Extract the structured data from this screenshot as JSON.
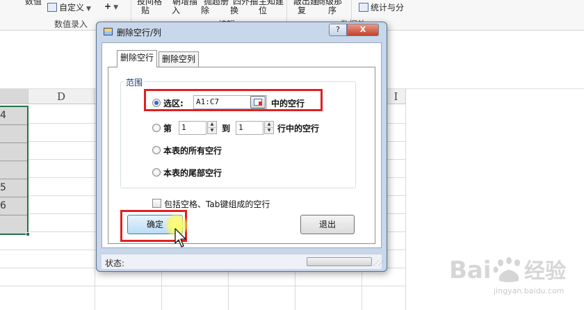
{
  "ribbon": {
    "items": [
      "数值",
      "自定义",
      "+",
      "贴",
      "入",
      "除",
      "换",
      "位",
      "复",
      "序",
      "统计与分"
    ],
    "top_fragments": [
      "投间格",
      "朝增描",
      "抛超册",
      "四外抽",
      "主知建",
      "敲出建",
      "商级那"
    ],
    "groups": [
      "数值录入",
      "编辑",
      "数据处"
    ]
  },
  "grid": {
    "columns": [
      "D",
      "I"
    ],
    "cell_values": [
      "4",
      "5",
      "6"
    ]
  },
  "dialog": {
    "title": "删除空行/列",
    "help_label": "?",
    "close_label": "X",
    "tabs": [
      "删除空行",
      "删除空列"
    ],
    "group_label": "范围",
    "option_selection_label": "选区:",
    "selection_value": "A1:C7",
    "selection_suffix": "中的空行",
    "option_range_prefix": "第",
    "range_from": "1",
    "range_to_label": "到",
    "range_to": "1",
    "range_suffix": "行中的空行",
    "option_all_label": "本表的所有空行",
    "option_tail_label": "本表的尾部空行",
    "include_spaces_label": "包括空格、Tab键组成的空行",
    "include_spaces_checked": false,
    "selected_option": "selection",
    "ok_label": "确定",
    "exit_label": "退出",
    "status_label": "状态:"
  },
  "watermark": {
    "logo": "Bai经验",
    "url": "jingyan.baidu.com"
  },
  "colors": {
    "highlight_red": "#e02020",
    "selection_green": "#217346",
    "dialog_frame": "#c9d7ea"
  }
}
